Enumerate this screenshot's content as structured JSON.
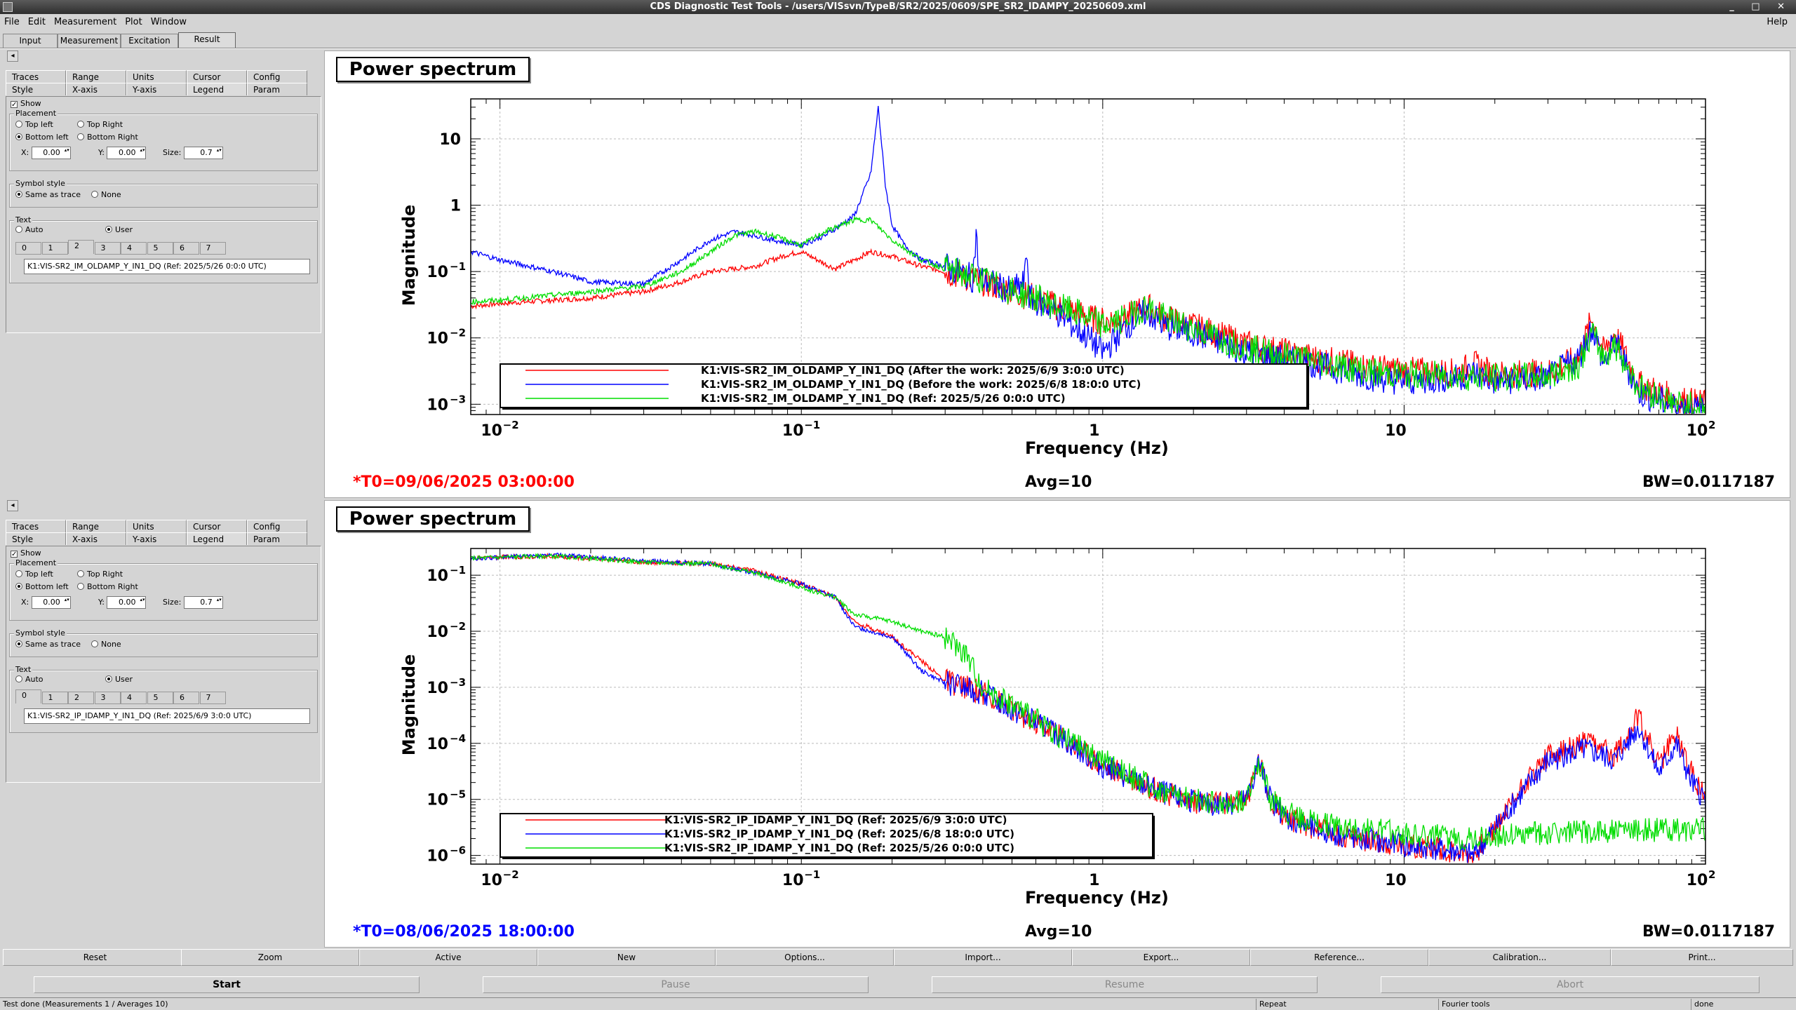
{
  "window": {
    "title": "CDS Diagnostic Test Tools - /users/VISsvn/TypeB/SR2/2025/0609/SPE_SR2_IDAMPY_20250609.xml",
    "buttons": "_ □ ✕"
  },
  "menu": {
    "items": [
      "File",
      "Edit",
      "Measurement",
      "Plot",
      "Window"
    ],
    "help": "Help"
  },
  "main_tabs": [
    "Input",
    "Measurement",
    "Excitation",
    "Result"
  ],
  "settings_tabs_row1": [
    "Traces",
    "Range",
    "Units",
    "Cursor",
    "Config"
  ],
  "settings_tabs_row2": [
    "Style",
    "X-axis",
    "Y-axis",
    "Legend",
    "Param"
  ],
  "legend_panel": {
    "show_label": "Show",
    "placement_title": "Placement",
    "top_left": "Top left",
    "top_right": "Top Right",
    "bottom_left": "Bottom left",
    "bottom_right": "Bottom Right",
    "x_label": "X:",
    "y_label": "Y:",
    "size_label": "Size:",
    "x_value": "0.00",
    "y_value": "0.00",
    "size_value": "0.7",
    "symbol_title": "Symbol style",
    "same_as_trace": "Same as trace",
    "none": "None",
    "text_title": "Text",
    "auto": "Auto",
    "user": "User",
    "trace_tabs": [
      "0",
      "1",
      "2",
      "3",
      "4",
      "5",
      "6",
      "7"
    ]
  },
  "panels": [
    {
      "legend_text": "K1:VIS-SR2_IM_OLDAMP_Y_IN1_DQ (Ref: 2025/5/26 0:0:0 UTC)"
    },
    {
      "legend_text": "K1:VIS-SR2_IP_IDAMP_Y_IN1_DQ (Ref: 2025/6/9 3:0:0 UTC)"
    }
  ],
  "plots": [
    {
      "title": "Power spectrum",
      "ylabel": "Magnitude",
      "xlabel": "Frequency (Hz)",
      "t0": "*T0=09/06/2025 03:00:00",
      "t0_color": "#ff0000",
      "avg": "Avg=10",
      "bw": "BW=0.0117187",
      "ytick_labels": [
        "10",
        "1",
        "10",
        "10",
        "10"
      ],
      "ytick_exps": [
        "",
        "",
        "−1",
        "−2",
        "−3"
      ],
      "legend": [
        {
          "color": "#ff0000",
          "label": "K1:VIS-SR2_IM_OLDAMP_Y_IN1_DQ (After the work: 2025/6/9 3:0:0 UTC)"
        },
        {
          "color": "#0000ff",
          "label": "K1:VIS-SR2_IM_OLDAMP_Y_IN1_DQ (Before the work: 2025/6/8 18:0:0 UTC)"
        },
        {
          "color": "#00dd00",
          "label": "K1:VIS-SR2_IM_OLDAMP_Y_IN1_DQ (Ref: 2025/5/26 0:0:0 UTC)"
        }
      ]
    },
    {
      "title": "Power spectrum",
      "ylabel": "Magnitude",
      "xlabel": "Frequency (Hz)",
      "t0": "*T0=08/06/2025 18:00:00",
      "t0_color": "#0000ff",
      "avg": "Avg=10",
      "bw": "BW=0.0117187",
      "ytick_labels": [
        "10",
        "10",
        "10",
        "10",
        "10",
        "10"
      ],
      "ytick_exps": [
        "−1",
        "−2",
        "−3",
        "−4",
        "−5",
        "−6"
      ],
      "legend": [
        {
          "color": "#ff0000",
          "label": "K1:VIS-SR2_IP_IDAMP_Y_IN1_DQ (Ref: 2025/6/9 3:0:0 UTC)"
        },
        {
          "color": "#0000ff",
          "label": "K1:VIS-SR2_IP_IDAMP_Y_IN1_DQ (Ref: 2025/6/8 18:0:0 UTC)"
        },
        {
          "color": "#00dd00",
          "label": "K1:VIS-SR2_IP_IDAMP_Y_IN1_DQ (Ref: 2025/5/26 0:0:0 UTC)"
        }
      ]
    }
  ],
  "xtick_labels": [
    "10",
    "10",
    "1",
    "10",
    "10"
  ],
  "xtick_exps": [
    "−2",
    "−1",
    "",
    "",
    "2"
  ],
  "bottom_buttons": [
    "Reset",
    "Zoom",
    "Active",
    "New",
    "Options...",
    "Import...",
    "Export...",
    "Reference...",
    "Calibration...",
    "Print..."
  ],
  "action_buttons": [
    "Start",
    "Pause",
    "Resume",
    "Abort"
  ],
  "status": {
    "message": "Test done (Measurements 1 / Averages 10)",
    "repeat": "Repeat",
    "fourier": "Fourier tools",
    "done": "done"
  },
  "chart_data": [
    {
      "type": "line",
      "title": "Power spectrum",
      "xlabel": "Frequency (Hz)",
      "ylabel": "Magnitude",
      "x_scale": "log",
      "y_scale": "log",
      "xlim": [
        0.008,
        100
      ],
      "ylim": [
        0.0007,
        40
      ],
      "grid": true,
      "legend_placement": "bottom-left",
      "series": [
        {
          "name": "K1:VIS-SR2_IM_OLDAMP_Y_IN1_DQ (After the work: 2025/6/9 3:0:0 UTC)",
          "color": "#ff0000",
          "x": [
            0.008,
            0.01,
            0.02,
            0.03,
            0.04,
            0.05,
            0.06,
            0.07,
            0.08,
            0.09,
            0.1,
            0.12,
            0.13,
            0.15,
            0.17,
            0.2,
            0.25,
            0.3,
            0.4,
            0.5,
            0.6,
            0.7,
            0.8,
            0.9,
            1.0,
            1.2,
            1.4,
            1.6,
            2,
            3,
            5,
            8,
            10,
            15,
            17,
            20,
            30,
            38,
            42,
            46,
            50,
            60,
            80,
            100
          ],
          "y": [
            0.03,
            0.033,
            0.04,
            0.05,
            0.07,
            0.1,
            0.11,
            0.12,
            0.15,
            0.18,
            0.2,
            0.13,
            0.11,
            0.15,
            0.2,
            0.17,
            0.12,
            0.1,
            0.07,
            0.05,
            0.04,
            0.03,
            0.025,
            0.02,
            0.018,
            0.02,
            0.03,
            0.02,
            0.015,
            0.008,
            0.005,
            0.0035,
            0.0032,
            0.003,
            0.004,
            0.0028,
            0.003,
            0.005,
            0.02,
            0.006,
            0.012,
            0.002,
            0.0012,
            0.001
          ]
        },
        {
          "name": "K1:VIS-SR2_IM_OLDAMP_Y_IN1_DQ (Before the work: 2025/6/8 18:0:0 UTC)",
          "color": "#0000ff",
          "x": [
            0.008,
            0.01,
            0.015,
            0.02,
            0.03,
            0.04,
            0.05,
            0.06,
            0.07,
            0.08,
            0.1,
            0.12,
            0.15,
            0.17,
            0.18,
            0.19,
            0.2,
            0.22,
            0.25,
            0.3,
            0.37,
            0.38,
            0.39,
            0.45,
            0.5,
            0.55,
            0.56,
            0.57,
            0.7,
            0.8,
            0.9,
            1.0,
            1.2,
            1.4,
            1.6,
            2,
            3,
            5,
            8,
            10,
            15,
            17,
            20,
            30,
            38,
            42,
            46,
            50,
            60,
            80,
            100
          ],
          "y": [
            0.2,
            0.15,
            0.1,
            0.07,
            0.065,
            0.15,
            0.3,
            0.4,
            0.35,
            0.3,
            0.25,
            0.35,
            0.7,
            3,
            30,
            2,
            0.5,
            0.25,
            0.15,
            0.12,
            0.08,
            0.35,
            0.08,
            0.06,
            0.05,
            0.07,
            0.25,
            0.04,
            0.025,
            0.015,
            0.01,
            0.006,
            0.015,
            0.025,
            0.015,
            0.012,
            0.006,
            0.004,
            0.0025,
            0.0022,
            0.0025,
            0.003,
            0.0022,
            0.0025,
            0.005,
            0.015,
            0.004,
            0.009,
            0.0015,
            0.0009,
            0.0008
          ]
        },
        {
          "name": "K1:VIS-SR2_IM_OLDAMP_Y_IN1_DQ (Ref: 2025/5/26 0:0:0 UTC)",
          "color": "#00dd00",
          "x": [
            0.008,
            0.01,
            0.02,
            0.03,
            0.04,
            0.05,
            0.06,
            0.07,
            0.08,
            0.1,
            0.12,
            0.15,
            0.17,
            0.2,
            0.25,
            0.3,
            0.4,
            0.5,
            0.6,
            0.7,
            0.8,
            0.9,
            1.0,
            1.2,
            1.4,
            1.6,
            2,
            3,
            5,
            8,
            10,
            15,
            20,
            30,
            38,
            42,
            46,
            50,
            60,
            80,
            100
          ],
          "y": [
            0.035,
            0.037,
            0.05,
            0.06,
            0.1,
            0.2,
            0.35,
            0.4,
            0.35,
            0.25,
            0.4,
            0.6,
            0.6,
            0.3,
            0.15,
            0.11,
            0.075,
            0.05,
            0.04,
            0.03,
            0.025,
            0.02,
            0.015,
            0.02,
            0.03,
            0.02,
            0.014,
            0.007,
            0.0045,
            0.003,
            0.0028,
            0.0027,
            0.0025,
            0.0027,
            0.004,
            0.012,
            0.005,
            0.008,
            0.0018,
            0.001,
            0.0009
          ]
        }
      ]
    },
    {
      "type": "line",
      "title": "Power spectrum",
      "xlabel": "Frequency (Hz)",
      "ylabel": "Magnitude",
      "x_scale": "log",
      "y_scale": "log",
      "xlim": [
        0.008,
        100
      ],
      "ylim": [
        7e-07,
        0.3
      ],
      "grid": true,
      "legend_placement": "bottom-left",
      "series": [
        {
          "name": "K1:VIS-SR2_IP_IDAMP_Y_IN1_DQ (Ref: 2025/6/9 3:0:0 UTC)",
          "color": "#ff0000",
          "x": [
            0.008,
            0.01,
            0.015,
            0.02,
            0.03,
            0.05,
            0.07,
            0.1,
            0.13,
            0.15,
            0.2,
            0.25,
            0.3,
            0.4,
            0.5,
            0.7,
            1,
            1.5,
            2,
            2.5,
            3,
            3.3,
            3.6,
            4,
            5,
            7,
            10,
            15,
            17,
            20,
            25,
            30,
            40,
            50,
            60,
            70,
            80,
            90,
            100
          ],
          "y": [
            0.2,
            0.21,
            0.22,
            0.2,
            0.17,
            0.16,
            0.12,
            0.07,
            0.04,
            0.015,
            0.008,
            0.003,
            0.0013,
            0.0008,
            0.0004,
            0.00015,
            4e-05,
            1.5e-05,
            9e-06,
            8e-06,
            1e-05,
            5e-05,
            1e-05,
            5e-06,
            3e-06,
            2e-06,
            1.5e-06,
            1.2e-06,
            1e-06,
            3e-06,
            2e-05,
            6e-05,
            0.0001,
            6e-05,
            0.0003,
            4e-05,
            0.00015,
            3e-05,
            1e-05
          ]
        },
        {
          "name": "K1:VIS-SR2_IP_IDAMP_Y_IN1_DQ (Ref: 2025/6/8 18:0:0 UTC)",
          "color": "#0000ff",
          "x": [
            0.008,
            0.01,
            0.015,
            0.02,
            0.03,
            0.05,
            0.07,
            0.1,
            0.13,
            0.15,
            0.2,
            0.25,
            0.3,
            0.4,
            0.5,
            0.7,
            1,
            1.5,
            2,
            2.5,
            3,
            3.3,
            3.6,
            4,
            5,
            7,
            10,
            15,
            17,
            20,
            25,
            30,
            40,
            50,
            60,
            70,
            80,
            90,
            100
          ],
          "y": [
            0.2,
            0.21,
            0.23,
            0.21,
            0.18,
            0.16,
            0.11,
            0.07,
            0.04,
            0.012,
            0.008,
            0.002,
            0.0012,
            0.0008,
            0.0004,
            0.00015,
            4e-05,
            1.5e-05,
            9e-06,
            8e-06,
            1e-05,
            5e-05,
            1e-05,
            5e-06,
            3e-06,
            2e-06,
            1.5e-06,
            1.2e-06,
            1e-06,
            3e-06,
            1.5e-05,
            5e-05,
            8e-05,
            5e-05,
            0.0002,
            3e-05,
            0.0001,
            2e-05,
            1e-05
          ]
        },
        {
          "name": "K1:VIS-SR2_IP_IDAMP_Y_IN1_DQ (Ref: 2025/5/26 0:0:0 UTC)",
          "color": "#00dd00",
          "x": [
            0.008,
            0.01,
            0.015,
            0.02,
            0.03,
            0.05,
            0.07,
            0.1,
            0.13,
            0.15,
            0.2,
            0.25,
            0.3,
            0.35,
            0.4,
            0.5,
            0.7,
            1,
            1.5,
            2,
            2.5,
            3,
            3.3,
            3.6,
            4,
            5,
            7,
            10,
            15,
            20,
            30,
            100
          ],
          "y": [
            0.2,
            0.21,
            0.22,
            0.2,
            0.17,
            0.16,
            0.11,
            0.06,
            0.04,
            0.02,
            0.015,
            0.01,
            0.008,
            0.004,
            0.001,
            0.0005,
            0.00015,
            5e-05,
            1.5e-05,
            1e-05,
            8e-06,
            1e-05,
            5e-05,
            1e-05,
            6e-06,
            4e-06,
            3e-06,
            2.5e-06,
            2e-06,
            2.2e-06,
            2.5e-06,
            3e-06
          ]
        }
      ]
    }
  ]
}
